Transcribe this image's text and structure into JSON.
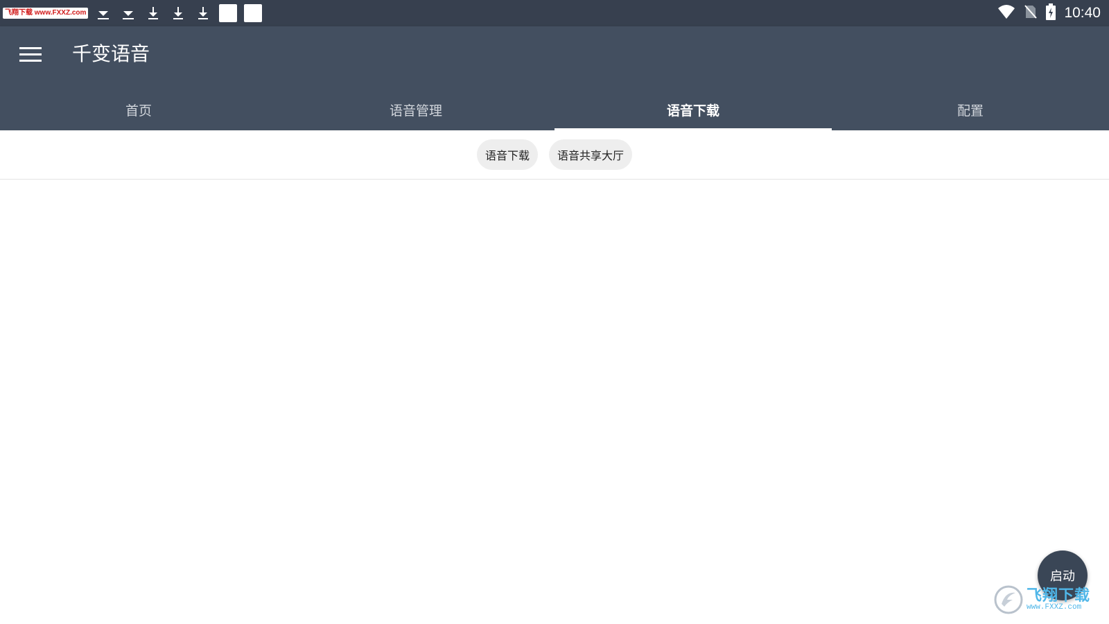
{
  "status_bar": {
    "watermark_badge": "飞翔下载 www.FXXZ.com",
    "time": "10:40",
    "left_icons": [
      "image-icon",
      "download-done-icon",
      "download-done-icon",
      "download-icon",
      "download-icon",
      "download-icon",
      "square-icon",
      "square-icon"
    ],
    "right_icons": [
      "wifi-icon",
      "no-sim-icon",
      "battery-charging-icon"
    ]
  },
  "app_bar": {
    "title": "千变语音",
    "menu_icon": "menu-icon",
    "background_color": "#434f60"
  },
  "tabs": [
    {
      "label": "首页",
      "active": false
    },
    {
      "label": "语音管理",
      "active": false
    },
    {
      "label": "语音下载",
      "active": true
    },
    {
      "label": "配置",
      "active": false
    }
  ],
  "sub_tabs": [
    {
      "label": "语音下载"
    },
    {
      "label": "语音共享大厅"
    }
  ],
  "fab": {
    "label": "启动"
  },
  "watermark": {
    "cn": "飞翔下载",
    "url": "www.FXXZ.com"
  }
}
